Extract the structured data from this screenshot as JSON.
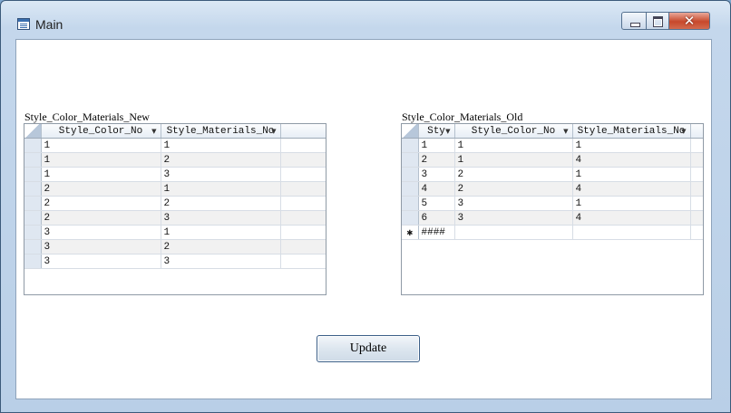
{
  "window": {
    "title": "Main",
    "close_glyph": "✕"
  },
  "grid_new": {
    "caption": "Style_Color_Materials_New",
    "columns": [
      "Style_Color_No",
      "Style_Materials_No"
    ],
    "rows": [
      [
        "1",
        "1"
      ],
      [
        "1",
        "2"
      ],
      [
        "1",
        "3"
      ],
      [
        "2",
        "1"
      ],
      [
        "2",
        "2"
      ],
      [
        "2",
        "3"
      ],
      [
        "3",
        "1"
      ],
      [
        "3",
        "2"
      ],
      [
        "3",
        "3"
      ]
    ]
  },
  "grid_old": {
    "caption": "Style_Color_Materials_Old",
    "columns": [
      "Sty",
      "Style_Color_No",
      "Style_Materials_No"
    ],
    "rows": [
      [
        "1",
        "1",
        "1"
      ],
      [
        "2",
        "1",
        "4"
      ],
      [
        "3",
        "2",
        "1"
      ],
      [
        "4",
        "2",
        "4"
      ],
      [
        "5",
        "3",
        "1"
      ],
      [
        "6",
        "3",
        "4"
      ]
    ],
    "new_row_marker": "✱",
    "new_row_value": "####"
  },
  "update_button": {
    "label": "Update"
  },
  "dropdown_glyph": "▼"
}
